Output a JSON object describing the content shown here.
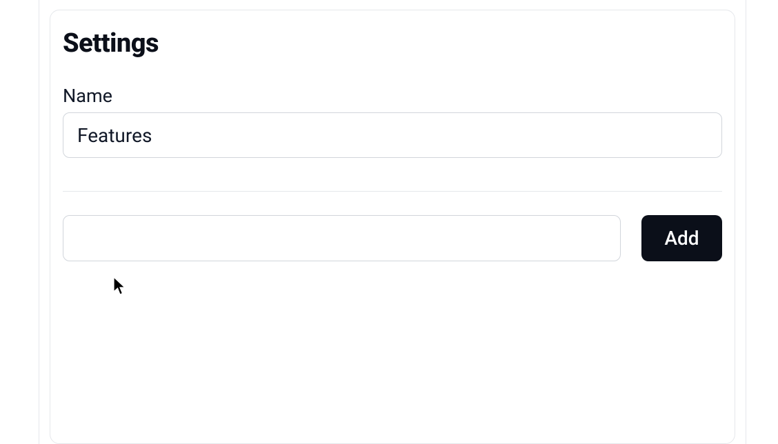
{
  "panel": {
    "title": "Settings",
    "name_field": {
      "label": "Name",
      "value": "Features"
    },
    "add_row": {
      "input_value": "",
      "button_label": "Add"
    }
  }
}
